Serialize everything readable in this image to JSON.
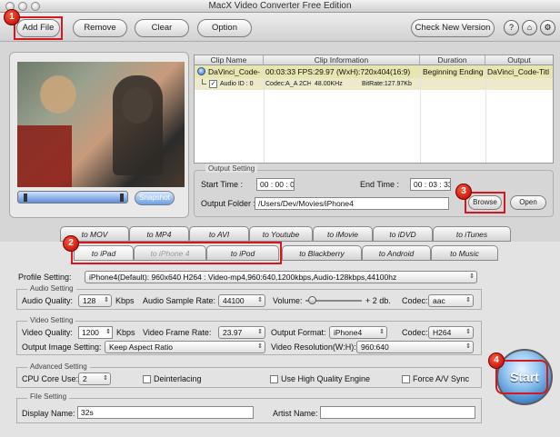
{
  "window": {
    "title": "MacX Video Converter Free Edition"
  },
  "toolbar": {
    "add_file": "Add File",
    "remove": "Remove",
    "clear": "Clear",
    "option": "Option",
    "check_new_version": "Check New Version"
  },
  "preview": {
    "snapshot": "Snapshot"
  },
  "clip_table": {
    "headers": [
      "Clip Name",
      "Clip Information",
      "Duration",
      "Output"
    ],
    "row": {
      "name": "DaVinci_Code-",
      "info": "00:03:33  FPS:29.97  (WxH):720x404(16:9)",
      "duration": "Beginning Ending",
      "output": "DaVinci_Code-Titl"
    },
    "audio_row": {
      "audio_id": "Audio ID : 0",
      "codec": "Codec:A_A 2CH",
      "rate": "48.00KHz",
      "bitrate": "BitRate:127.97Kb"
    }
  },
  "output_setting": {
    "legend": "Output Setting",
    "start_time_label": "Start Time :",
    "start_time": "00 : 00 : 00",
    "end_time_label": "End Time :",
    "end_time": "00 : 03 : 33",
    "output_folder_label": "Output Folder :",
    "output_folder": "/Users/Dev/Movies/iPhone4",
    "browse": "Browse",
    "open": "Open"
  },
  "tabs_row1": [
    "to MOV",
    "to MP4",
    "to AVI",
    "to Youtube",
    "to iMovie",
    "to iDVD",
    "to iTunes"
  ],
  "tabs_row2": [
    "to iPad",
    "to iPhone 4",
    "to iPod",
    "to Blackberry",
    "to Android",
    "to Music"
  ],
  "profile": {
    "label": "Profile Setting:",
    "value": "iPhone4(Default): 960x640 H264 : Video-mp4,960:640,1200kbps,Audio-128kbps,44100hz"
  },
  "audio_setting": {
    "legend": "Audio Setting",
    "quality_label": "Audio Quality:",
    "quality": "128",
    "kbps": "Kbps",
    "sample_rate_label": "Audio Sample Rate:",
    "sample_rate": "44100",
    "volume_label": "Volume:",
    "volume_value": "+ 2 db.",
    "codec_label": "Codec:",
    "codec": "aac"
  },
  "video_setting": {
    "legend": "Video Setting",
    "quality_label": "Video Quality:",
    "quality": "1200",
    "kbps": "Kbps",
    "frame_rate_label": "Video Frame Rate:",
    "frame_rate": "23.97",
    "output_format_label": "Output Format:",
    "output_format": "iPhone4",
    "codec_label": "Codec:",
    "codec": "H264",
    "image_setting_label": "Output Image Setting:",
    "image_setting": "Keep Aspect Ratio",
    "resolution_label": "Video Resolution(W:H):",
    "resolution": "960:640"
  },
  "advanced_setting": {
    "legend": "Advanced Setting",
    "cpu_label": "CPU Core Use:",
    "cpu": "2",
    "deinterlacing": "Deinterlacing",
    "high_quality": "Use High Quality Engine",
    "force_av_sync": "Force A/V Sync"
  },
  "file_setting": {
    "legend": "File Setting",
    "display_name_label": "Display Name:",
    "display_name": "32s",
    "artist_name_label": "Artist Name:",
    "artist_name": ""
  },
  "start_button": "Start",
  "annotations": [
    "1",
    "2",
    "3",
    "4"
  ]
}
